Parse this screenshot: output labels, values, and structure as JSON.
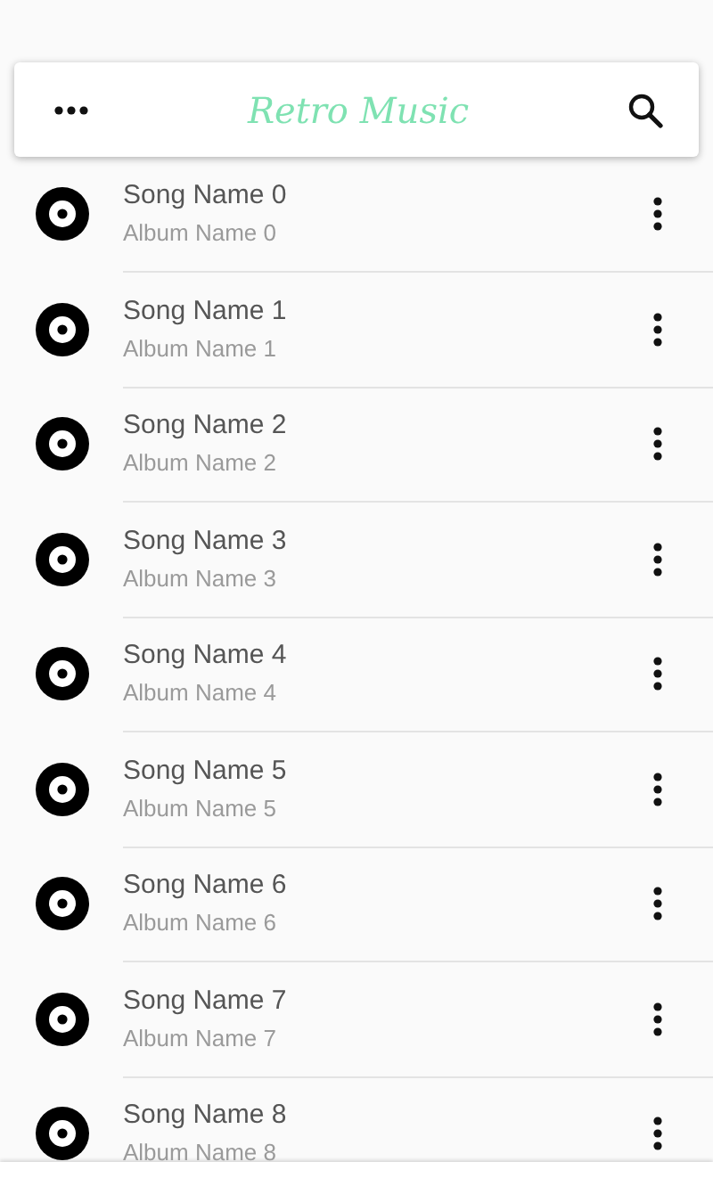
{
  "toolbar": {
    "title": "Retro Music"
  },
  "songs": [
    {
      "title": "Song Name 0",
      "album": "Album Name 0"
    },
    {
      "title": "Song Name 1",
      "album": "Album Name 1"
    },
    {
      "title": "Song Name 2",
      "album": "Album Name 2"
    },
    {
      "title": "Song Name 3",
      "album": "Album Name 3"
    },
    {
      "title": "Song Name 4",
      "album": "Album Name 4"
    },
    {
      "title": "Song Name 5",
      "album": "Album Name 5"
    },
    {
      "title": "Song Name 6",
      "album": "Album Name 6"
    },
    {
      "title": "Song Name 7",
      "album": "Album Name 7"
    },
    {
      "title": "Song Name 8",
      "album": "Album Name 8"
    }
  ]
}
